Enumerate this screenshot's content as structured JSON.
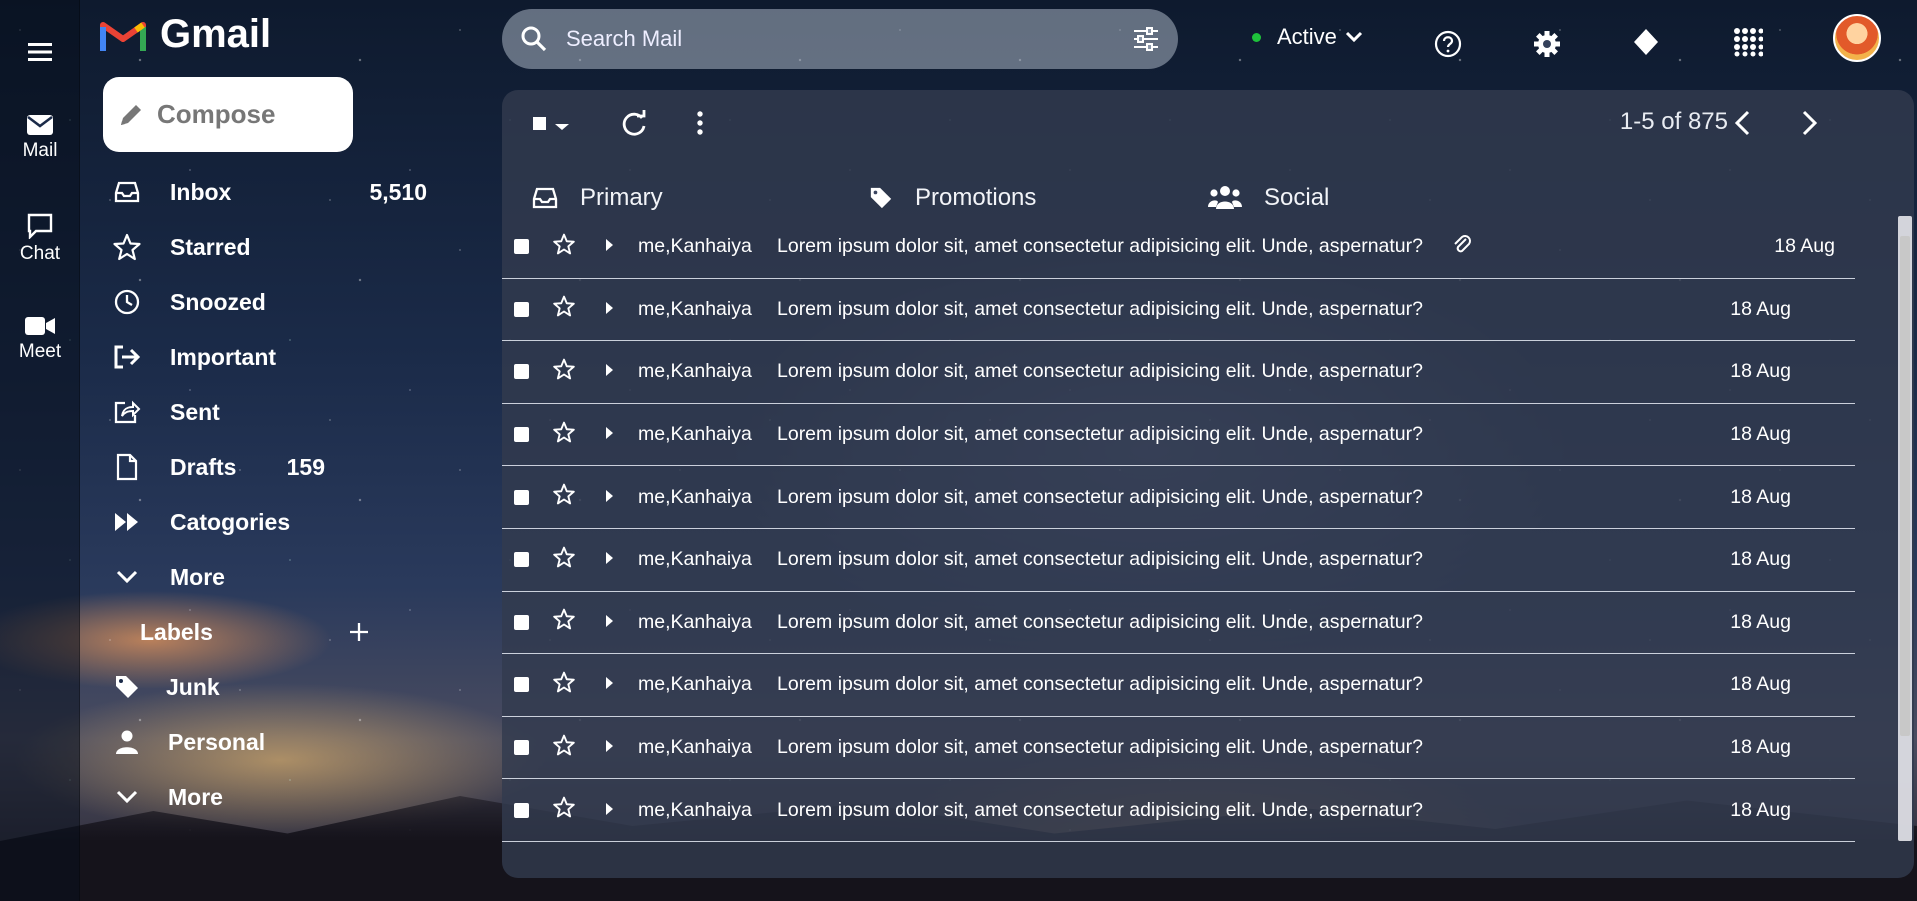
{
  "app": {
    "name": "Gmail"
  },
  "rail": {
    "items": [
      {
        "label": "Mail",
        "icon": "mail-icon"
      },
      {
        "label": "Chat",
        "icon": "chat-icon"
      },
      {
        "label": "Meet",
        "icon": "video-icon"
      }
    ]
  },
  "compose": {
    "label": "Compose"
  },
  "sidebar": {
    "items": [
      {
        "label": "Inbox",
        "count": "5,510",
        "icon": "inbox-icon"
      },
      {
        "label": "Starred",
        "count": "",
        "icon": "star-icon"
      },
      {
        "label": "Snoozed",
        "count": "",
        "icon": "clock-icon"
      },
      {
        "label": "Important",
        "count": "",
        "icon": "important-icon"
      },
      {
        "label": "Sent",
        "count": "",
        "icon": "send-icon"
      },
      {
        "label": "Drafts",
        "count": "159",
        "icon": "draft-icon"
      },
      {
        "label": "Catogories",
        "count": "",
        "icon": "fast-forward-icon"
      },
      {
        "label": "More",
        "count": "",
        "icon": "chevron-down-icon"
      }
    ],
    "labels_heading": "Labels",
    "labels": [
      {
        "label": "Junk",
        "icon": "tag-icon"
      },
      {
        "label": "Personal",
        "icon": "person-icon"
      },
      {
        "label": "More",
        "icon": "chevron-down-icon"
      }
    ]
  },
  "search": {
    "placeholder": "Search Mail"
  },
  "status": {
    "label": "Active",
    "color": "#1ec23b"
  },
  "toolbar": {
    "pagination": "1-5 of 875"
  },
  "tabs": [
    {
      "label": "Primary",
      "icon": "inbox-icon"
    },
    {
      "label": "Promotions",
      "icon": "tag-icon"
    },
    {
      "label": "Social",
      "icon": "people-icon"
    }
  ],
  "emails": [
    {
      "from": "me,Kanhaiya",
      "subject": "Lorem ipsum dolor sit, amet consectetur adipisicing elit. Unde, aspernatur?",
      "date": "18 Aug",
      "attachment": true
    },
    {
      "from": "me,Kanhaiya",
      "subject": "Lorem ipsum dolor sit, amet consectetur adipisicing elit. Unde, aspernatur?",
      "date": "18 Aug",
      "attachment": false
    },
    {
      "from": "me,Kanhaiya",
      "subject": "Lorem ipsum dolor sit, amet consectetur adipisicing elit. Unde, aspernatur?",
      "date": "18 Aug",
      "attachment": false
    },
    {
      "from": "me,Kanhaiya",
      "subject": "Lorem ipsum dolor sit, amet consectetur adipisicing elit. Unde, aspernatur?",
      "date": "18 Aug",
      "attachment": false
    },
    {
      "from": "me,Kanhaiya",
      "subject": "Lorem ipsum dolor sit, amet consectetur adipisicing elit. Unde, aspernatur?",
      "date": "18 Aug",
      "attachment": false
    },
    {
      "from": "me,Kanhaiya",
      "subject": "Lorem ipsum dolor sit, amet consectetur adipisicing elit. Unde, aspernatur?",
      "date": "18 Aug",
      "attachment": false
    },
    {
      "from": "me,Kanhaiya",
      "subject": "Lorem ipsum dolor sit, amet consectetur adipisicing elit. Unde, aspernatur?",
      "date": "18 Aug",
      "attachment": false
    },
    {
      "from": "me,Kanhaiya",
      "subject": "Lorem ipsum dolor sit, amet consectetur adipisicing elit. Unde, aspernatur?",
      "date": "18 Aug",
      "attachment": false
    },
    {
      "from": "me,Kanhaiya",
      "subject": "Lorem ipsum dolor sit, amet consectetur adipisicing elit. Unde, aspernatur?",
      "date": "18 Aug",
      "attachment": false
    },
    {
      "from": "me,Kanhaiya",
      "subject": "Lorem ipsum dolor sit, amet consectetur adipisicing elit. Unde, aspernatur?",
      "date": "18 Aug",
      "attachment": false
    }
  ]
}
